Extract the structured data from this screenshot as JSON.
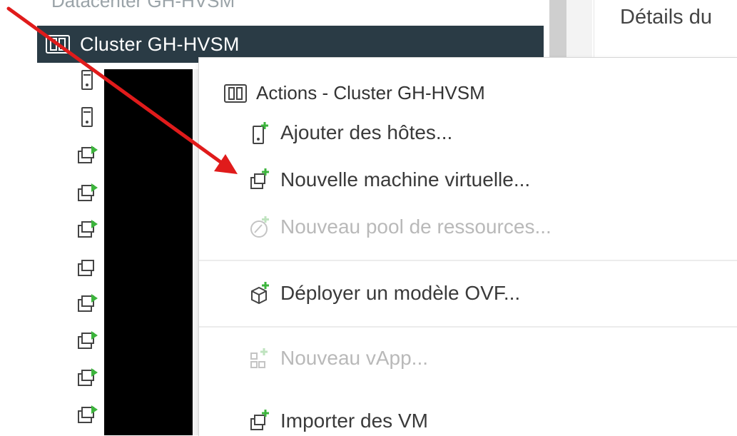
{
  "tree": {
    "datacenter_label": "Datacenter GH-HVSM",
    "cluster_label": "Cluster GH-HVSM",
    "child_icons": [
      "host-icon",
      "host-icon",
      "vm-on-icon",
      "vm-on-icon",
      "vm-on-icon",
      "vm-off-icon",
      "vm-on-icon",
      "vm-on-icon",
      "vm-on-icon",
      "vm-on-icon",
      "vm-on-icon"
    ]
  },
  "details": {
    "title": "Détails du"
  },
  "menu": {
    "header": "Actions - Cluster GH-HVSM",
    "items": [
      {
        "label": "Ajouter des hôtes...",
        "icon": "add-host-icon",
        "enabled": true
      },
      {
        "label": "Nouvelle machine virtuelle...",
        "icon": "new-vm-icon",
        "enabled": true
      },
      {
        "label": "Nouveau pool de ressources...",
        "icon": "resource-pool-icon",
        "enabled": false
      },
      {
        "label": "Déployer un modèle OVF...",
        "icon": "deploy-ovf-icon",
        "enabled": true
      },
      {
        "label": "Nouveau vApp...",
        "icon": "new-vapp-icon",
        "enabled": false
      },
      {
        "label": "Importer des VM",
        "icon": "import-vm-icon",
        "enabled": true
      }
    ]
  },
  "colors": {
    "selected_row": "#2a3b45",
    "accent_green": "#3cb43c",
    "annotation_red": "#e01b1b",
    "disabled_text": "#b9b9b9"
  }
}
